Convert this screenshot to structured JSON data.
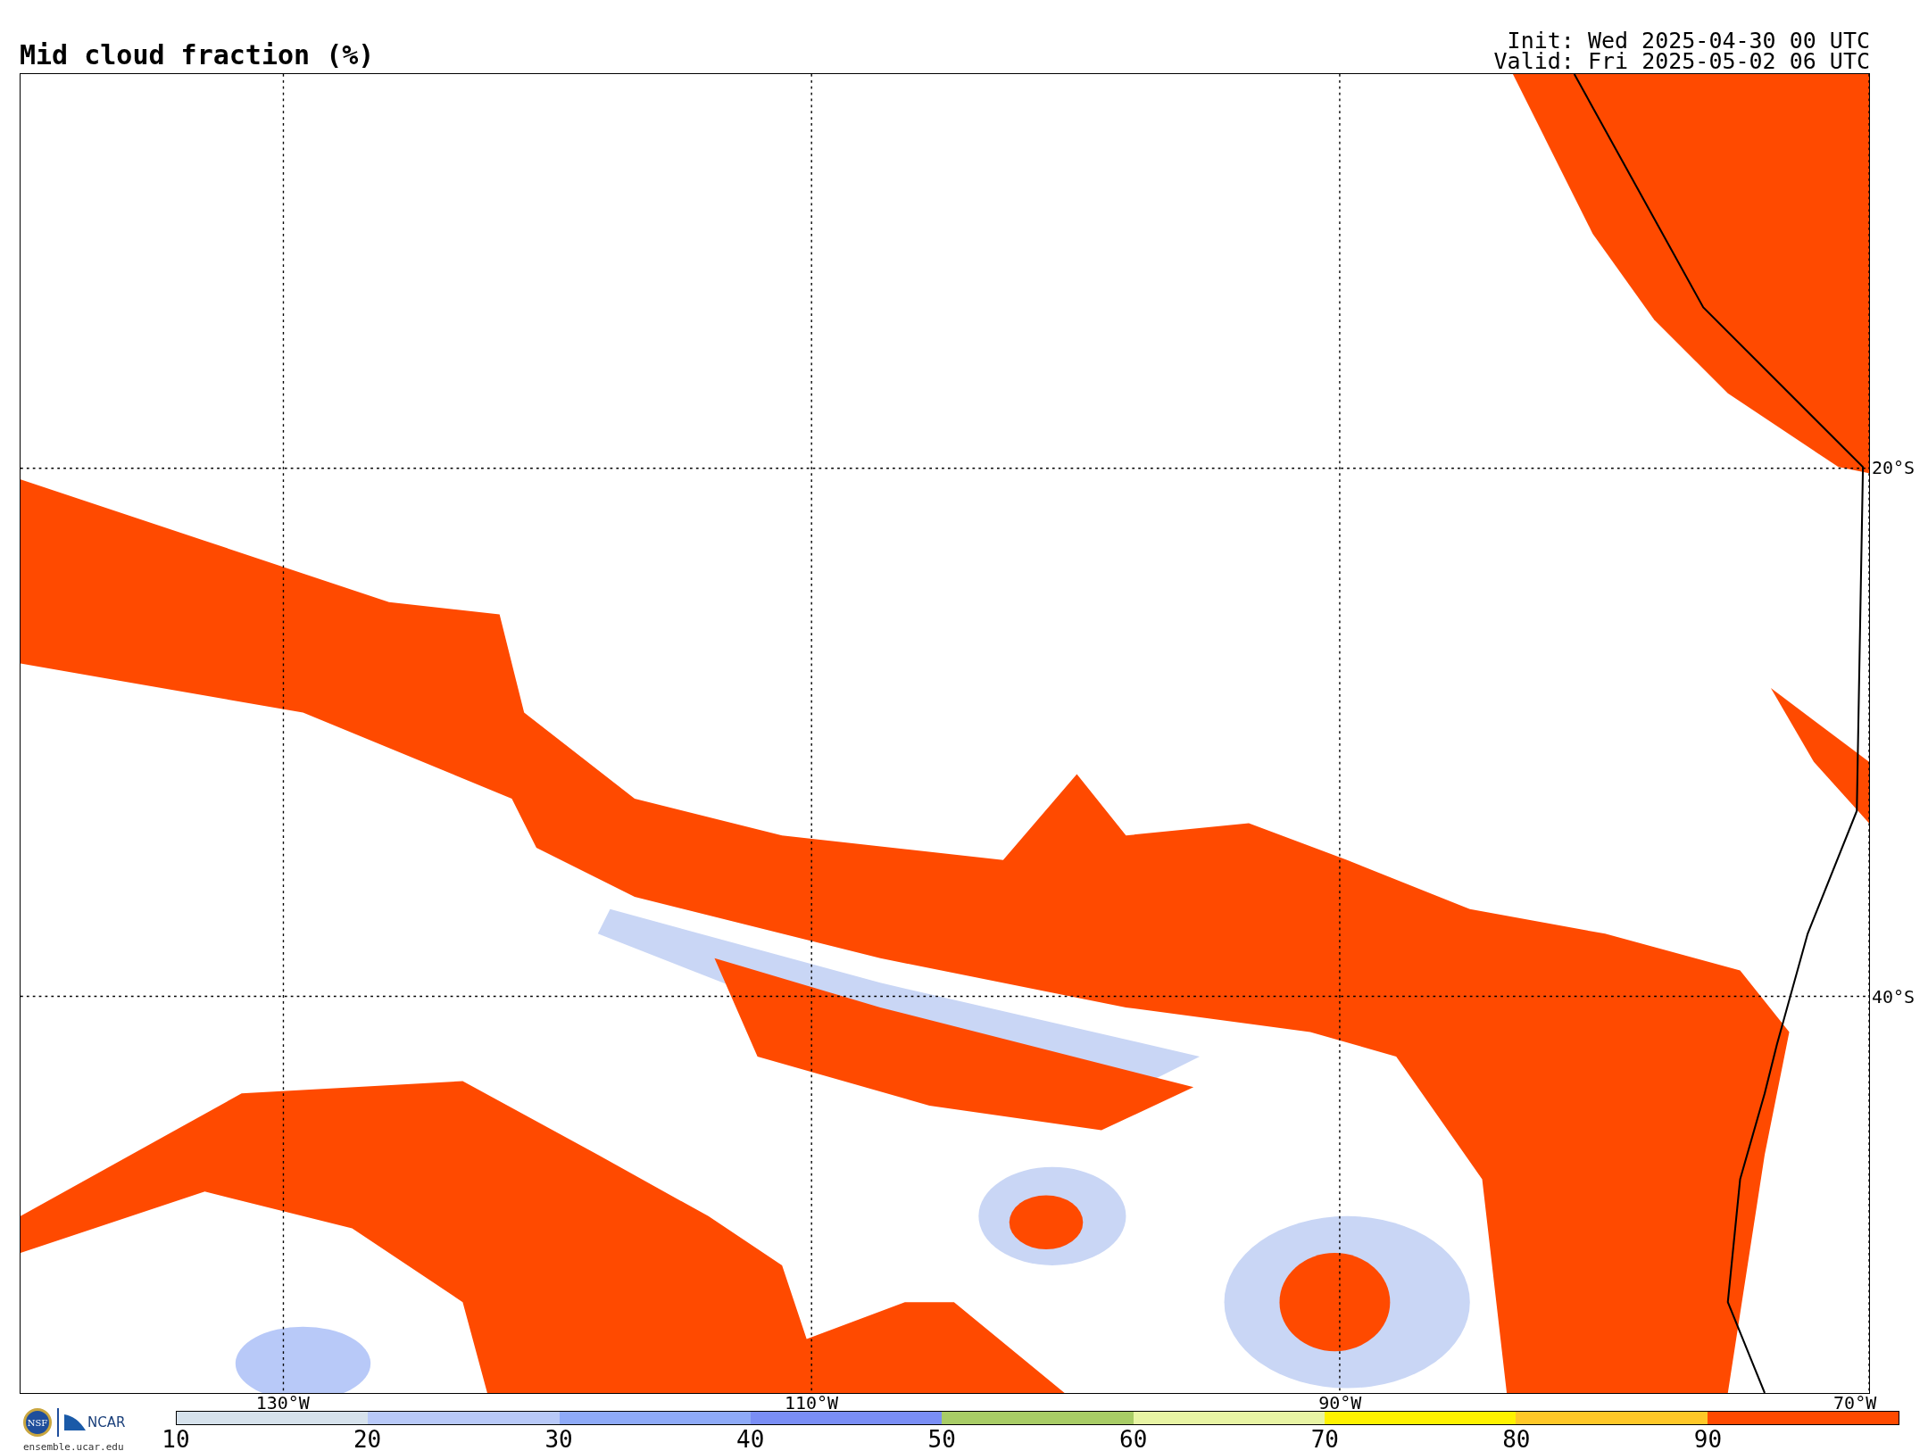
{
  "header": {
    "title": "Mid cloud fraction (%)",
    "init": "Init: Wed 2025-04-30 00 UTC",
    "valid": "Valid: Fri 2025-05-02 06 UTC"
  },
  "map": {
    "lon_labels": [
      "130°W",
      "110°W",
      "90°W",
      "70°W"
    ],
    "lat_labels": [
      "20°S",
      "40°S"
    ]
  },
  "logos": {
    "nsf": "NSF",
    "ncar": "NCAR",
    "url": "ensemble.ucar.edu"
  },
  "colorbar": {
    "segments": [
      {
        "color": "#d6e2ec"
      },
      {
        "color": "#b8c9f8"
      },
      {
        "color": "#8eaaf7"
      },
      {
        "color": "#7a8ef5"
      },
      {
        "color": "#a8cc66"
      },
      {
        "color": "#e8f4a4"
      },
      {
        "color": "#fff200"
      },
      {
        "color": "#ffc828"
      },
      {
        "color": "#ff4a00"
      }
    ],
    "ticks": [
      "10",
      "20",
      "30",
      "40",
      "50",
      "60",
      "70",
      "80",
      "90"
    ]
  }
}
